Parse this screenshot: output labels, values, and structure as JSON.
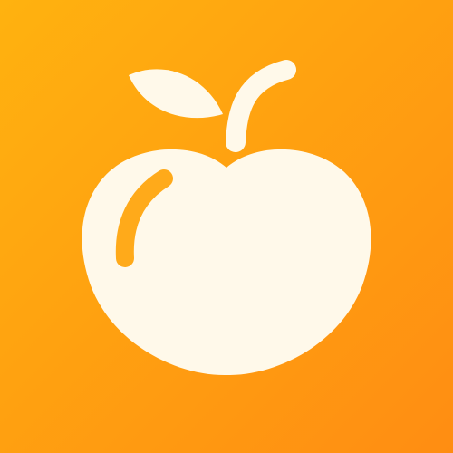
{
  "icon": {
    "name": "apple-icon",
    "colors": {
      "background_top": "#ffb20f",
      "background_bottom": "#ff8d12",
      "glyph": "#fff9ea",
      "highlight": "#ffaa1a"
    }
  }
}
